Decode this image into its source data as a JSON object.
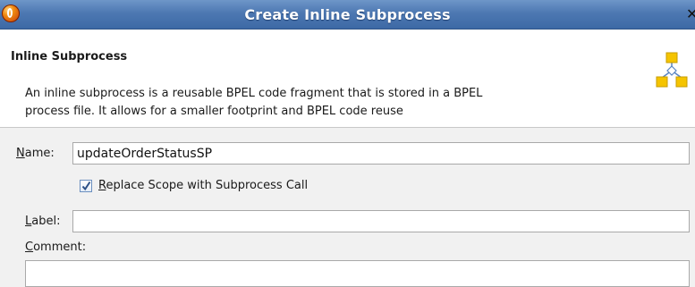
{
  "window": {
    "title": "Create Inline Subprocess",
    "close_glyph": "✕"
  },
  "header": {
    "title": "Inline Subprocess",
    "description_line1": "An inline subprocess is a reusable BPEL code fragment that is stored in a BPEL",
    "description_line2": "process file. It allows for a smaller footprint and BPEL code reuse",
    "icon": "subprocess-diagram-icon"
  },
  "form": {
    "name": {
      "label_mnemonic": "N",
      "label_rest": "ame:",
      "value": "updateOrderStatusSP"
    },
    "replace_scope": {
      "checked": true,
      "label_mnemonic": "R",
      "label_rest": "eplace Scope with Subprocess Call"
    },
    "label": {
      "label_mnemonic": "L",
      "label_rest": "abel:",
      "value": ""
    },
    "comment": {
      "label_mnemonic": "C",
      "label_rest": "omment:",
      "value": ""
    }
  },
  "colors": {
    "titlebar": "#4d78b2",
    "icon_yellow": "#f5c400",
    "icon_blue": "#5a86c4"
  }
}
